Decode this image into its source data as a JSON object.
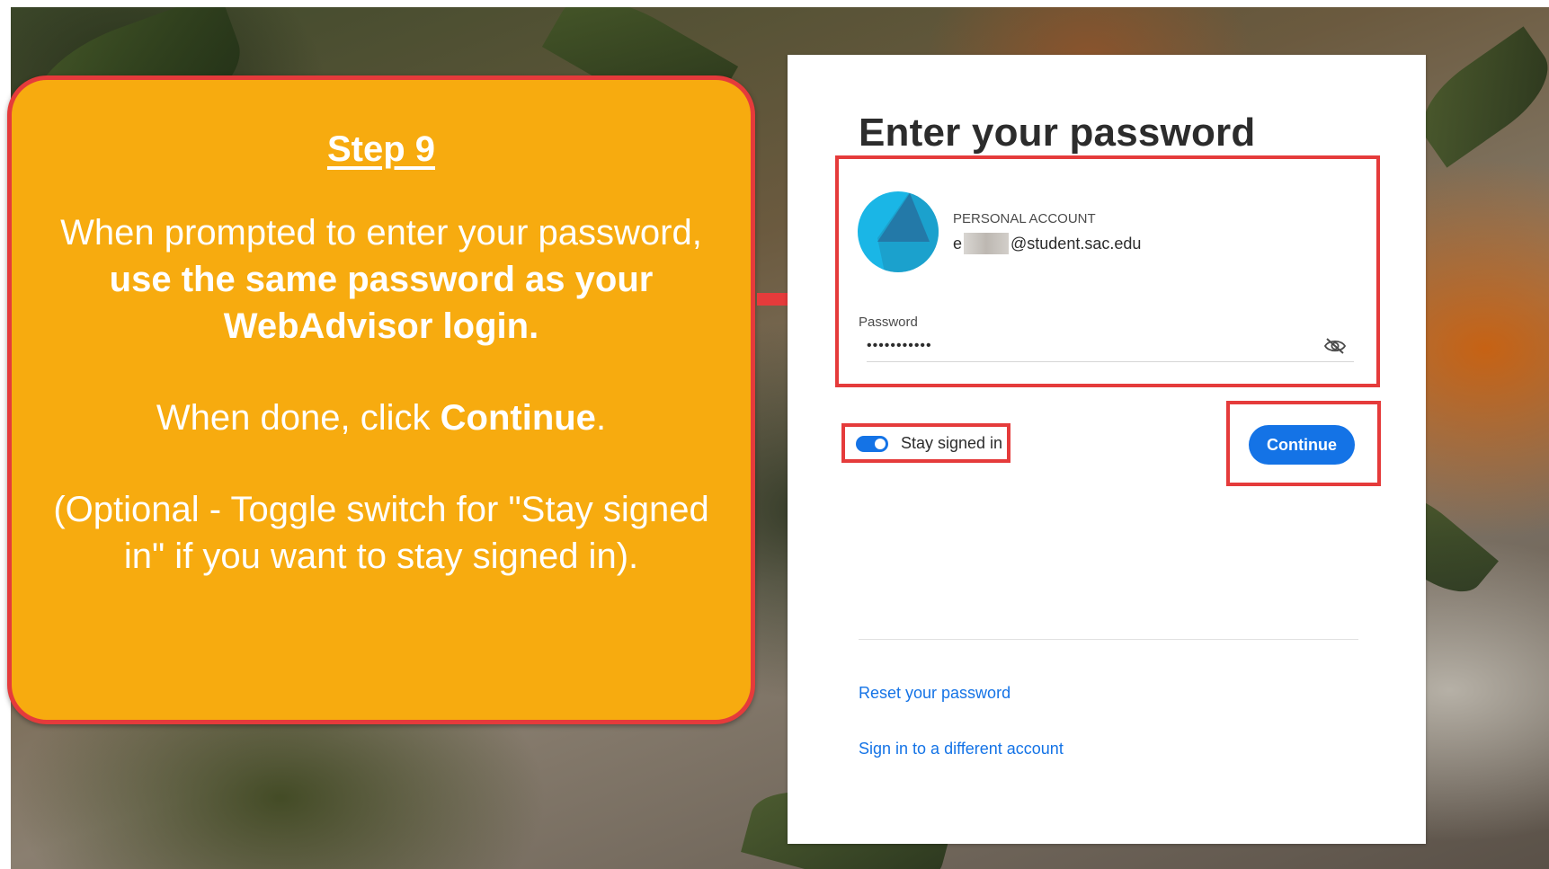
{
  "callout": {
    "step": "Step 9",
    "p1_pre": "When prompted to enter your password, ",
    "p1_bold": "use the same password as your WebAdvisor login.",
    "p2_pre": "When done, click ",
    "p2_bold": "Continue",
    "p2_post": ".",
    "p3": "(Optional - Toggle switch for \"Stay signed in\" if you want to stay signed in)."
  },
  "card": {
    "title": "Enter your password",
    "account": {
      "type_label": "PERSONAL ACCOUNT",
      "email_prefix": "e",
      "email_domain": "@student.sac.edu"
    },
    "password": {
      "label": "Password",
      "value": "•••••••••••",
      "visibility_icon": "eye-off-icon"
    },
    "stay_signed_in": {
      "label": "Stay signed in",
      "on": true
    },
    "continue_label": "Continue",
    "links": {
      "reset": "Reset your password",
      "different_account": "Sign in to a different account"
    }
  },
  "colors": {
    "callout_bg": "#f7ab0f",
    "highlight": "#e53b3b",
    "accent": "#1473e6",
    "avatar": "#1ab6e6"
  }
}
